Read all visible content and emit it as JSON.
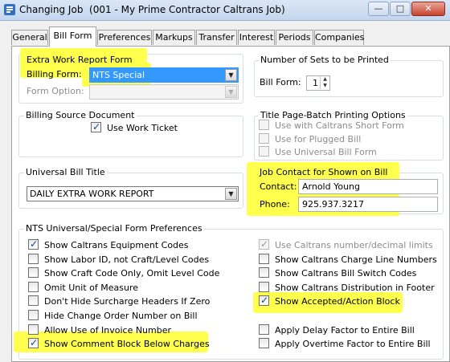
{
  "window": {
    "title": "Changing Job  (001 - My Prime Contractor Caltrans Job)",
    "minimize_glyph": "—",
    "maximize_glyph": "□",
    "close_glyph": "✕"
  },
  "tabs": [
    {
      "label": "General"
    },
    {
      "label": "Bill Form",
      "active": true
    },
    {
      "label": "Preferences"
    },
    {
      "label": "Markups"
    },
    {
      "label": "Transfer"
    },
    {
      "label": "Interest"
    },
    {
      "label": "Periods"
    },
    {
      "label": "Companies"
    }
  ],
  "extra_work": {
    "title": "Extra Work Report Form",
    "billing_form_label": "Billing Form:",
    "billing_form_value": "NTS Special",
    "form_option_label": "Form Option:",
    "form_option_value": ""
  },
  "sets": {
    "title": "Number of Sets to be Printed",
    "bill_form_label": "Bill Form:",
    "bill_form_value": "1"
  },
  "billing_source": {
    "title": "Billing Source Document",
    "use_work_ticket": {
      "label": "Use Work Ticket",
      "checked": true
    }
  },
  "title_page": {
    "title": "Title Page-Batch Printing Options",
    "options": [
      {
        "label": "Use with Caltrans Short Form",
        "checked": false
      },
      {
        "label": "Use for Plugged Bill",
        "checked": false
      },
      {
        "label": "Use Universal Bill Form",
        "checked": false
      }
    ]
  },
  "universal_title": {
    "title": "Universal Bill Title",
    "value": "DAILY EXTRA WORK REPORT"
  },
  "job_contact": {
    "title": "Job Contact for Shown on Bill",
    "contact_label": "Contact:",
    "contact_value": "Arnold Young",
    "phone_label": "Phone:",
    "phone_value": "925.937.3217"
  },
  "preferences": {
    "title": "NTS Universal/Special Form Preferences",
    "left": [
      {
        "label": "Show Caltrans Equipment Codes",
        "checked": true
      },
      {
        "label": "Show Labor ID, not Craft/Level Codes",
        "checked": false
      },
      {
        "label": "Show Craft Code Only, Omit Level Code",
        "checked": false
      },
      {
        "label": "Omit Unit of Measure",
        "checked": false
      },
      {
        "label": "Don't Hide Surcharge Headers If Zero",
        "checked": false
      },
      {
        "label": "Hide Change Order Number on Bill",
        "checked": false
      },
      {
        "label": "Allow Use of Invoice Number",
        "checked": false
      },
      {
        "label": "Show Comment Block Below Charges",
        "checked": true
      }
    ],
    "right": [
      {
        "label": "Use Caltrans number/decimal limits",
        "checked": true,
        "disabled": true
      },
      {
        "label": "Show Caltrans Charge Line Numbers",
        "checked": false
      },
      {
        "label": "Show Caltrans Bill Switch Codes",
        "checked": false
      },
      {
        "label": "Show Caltrans Distribution in Footer",
        "checked": false
      },
      {
        "label": "Show Accepted/Action Block",
        "checked": true
      },
      {
        "label": "",
        "checked": false,
        "hidden": true
      },
      {
        "label": "Apply Delay Factor to Entire Bill",
        "checked": false
      },
      {
        "label": "Apply Overtime Factor to Entire Bill",
        "checked": false
      }
    ]
  },
  "colors": {
    "highlight": "#ffff4d",
    "selection": "#3399ff",
    "check": "#1b3f8b"
  }
}
